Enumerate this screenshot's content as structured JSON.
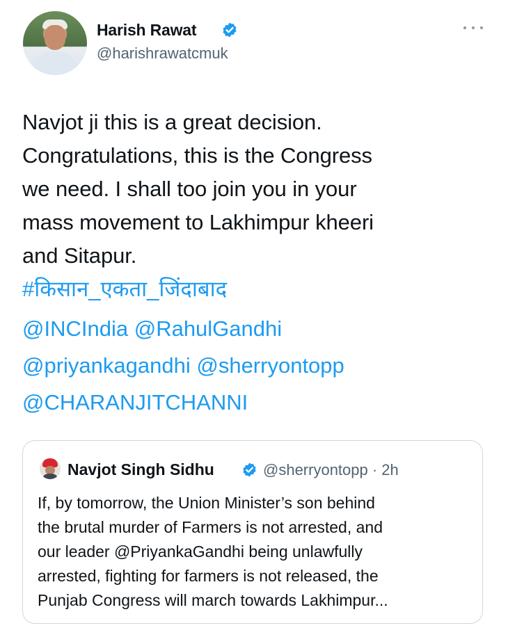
{
  "tweet": {
    "author_name": "Harish Rawat",
    "handle": "@harishrawatcmuk",
    "text_lines": [
      "Navjot ji this is a great decision.",
      "Congratulations, this is the Congress",
      "we need. I shall too join you in your",
      "mass movement to Lakhimpur kheeri",
      "and Sitapur."
    ],
    "hashtag": "#किसान_एकता_जिंदाबाद",
    "mentions": {
      "inc": "@INCIndia",
      "rahul": "@RahulGandhi",
      "priyanka": "@priyankagandhi",
      "sherry": "@sherryontopp",
      "channi": "@CHARANJITCHANNI"
    },
    "icons": {
      "avatar": "profile-photo",
      "verified": "verified-badge-icon",
      "more": "more-options-icon"
    },
    "colors": {
      "link": "#1d9bf0",
      "secondary_text": "#536471",
      "border": "#cfd9de"
    }
  },
  "quoted_tweet": {
    "author_name": "Navjot Singh Sidhu",
    "handle_time": "@sherryontopp · 2h",
    "text_lines": [
      "If, by tomorrow, the Union Minister’s son behind",
      "the brutal murder of Farmers is not arrested, and",
      "our leader @PriyankaGandhi being unlawfully",
      "arrested, fighting for farmers is not released, the",
      "Punjab Congress will march towards Lakhimpur..."
    ]
  }
}
